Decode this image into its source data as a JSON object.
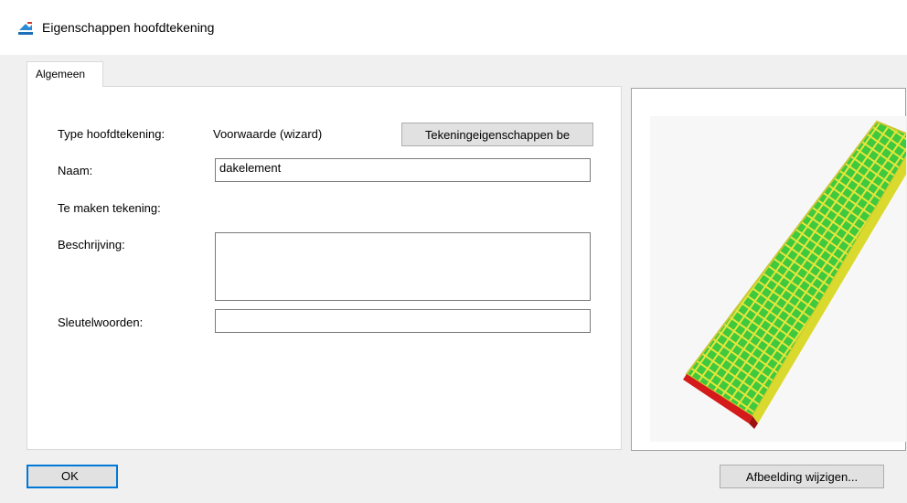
{
  "window": {
    "title": "Eigenschappen hoofdtekening",
    "icon": "app-drawing-icon"
  },
  "tabs": [
    {
      "label": "Algemeen",
      "active": true
    }
  ],
  "form": {
    "type_label": "Type hoofdtekening:",
    "type_value": "Voorwaarde (wizard)",
    "drawing_props_button": "Tekeningeigenschappen be",
    "name_label": "Naam:",
    "name_value": "dakelement",
    "create_drawing_label": "Te maken tekening:",
    "description_label": "Beschrijving:",
    "description_value": "",
    "keywords_label": "Sleutelwoorden:",
    "keywords_value": ""
  },
  "preview": {
    "image": "roof-element-3d-preview",
    "colors": {
      "panel": "#3cc93c",
      "frame": "#e8e83a",
      "edge": "#d41a1a"
    }
  },
  "buttons": {
    "ok": "OK",
    "change_image": "Afbeelding wijzigen..."
  }
}
